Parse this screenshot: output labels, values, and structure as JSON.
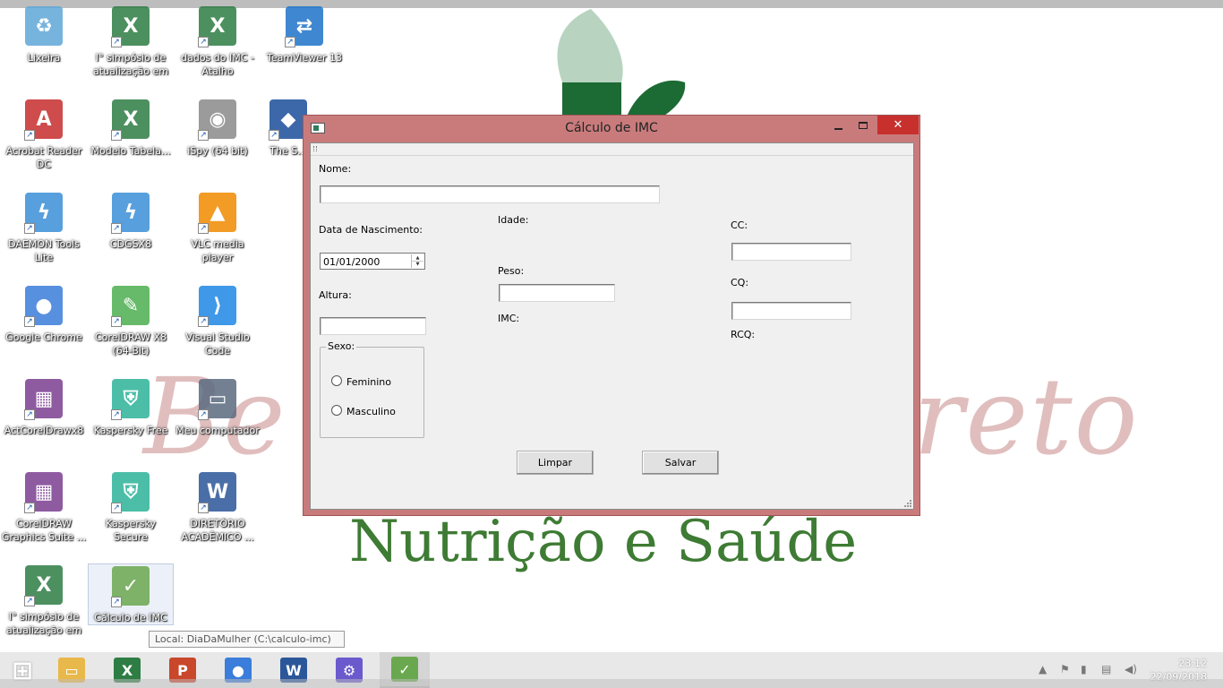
{
  "desktop": {
    "icons": [
      {
        "label": "Lixeira",
        "icon": "recycle-bin-icon",
        "color": "#5fa8d8"
      },
      {
        "label": "I° simpósio de atualização em ...",
        "icon": "excel-file-icon",
        "color": "#2e7d44"
      },
      {
        "label": "dados do IMC - Atalho",
        "icon": "excel-file-icon",
        "color": "#2e7d44"
      },
      {
        "label": "TeamViewer 13",
        "icon": "teamviewer-icon",
        "color": "#1e74c9"
      },
      {
        "label": "Acrobat Reader DC",
        "icon": "acrobat-icon",
        "color": "#c62d2d"
      },
      {
        "label": "Modelo Tabela...",
        "icon": "excel-file-icon",
        "color": "#2e7d44"
      },
      {
        "label": "iSpy (64 bit)",
        "icon": "ispy-eye-icon",
        "color": "#8a8a8a"
      },
      {
        "label": "The S...",
        "icon": "sims-icon",
        "color": "#1b4e9b"
      },
      {
        "label": "DAEMON Tools Lite",
        "icon": "daemon-tools-icon",
        "color": "#3a8fd8"
      },
      {
        "label": "CDGSX8",
        "icon": "lightning-icon",
        "color": "#3a8fd8"
      },
      {
        "label": "VLC media player",
        "icon": "vlc-cone-icon",
        "color": "#f08a00"
      },
      {
        "label": "Google Chrome",
        "icon": "chrome-icon",
        "color": "#3b7ddb"
      },
      {
        "label": "CorelDRAW X8 (64-Bit)",
        "icon": "coreldraw-icon",
        "color": "#4caf50"
      },
      {
        "label": "Visual Studio Code",
        "icon": "vscode-icon",
        "color": "#1e88e5"
      },
      {
        "label": "ActCorelDrawx8",
        "icon": "winrar-archive-icon",
        "color": "#7b3f91"
      },
      {
        "label": "Kaspersky Free",
        "icon": "kaspersky-shield-icon",
        "color": "#2db39a"
      },
      {
        "label": "Meu computador",
        "icon": "computer-icon",
        "color": "#5a6b80"
      },
      {
        "label": "CorelDRAW Graphics Suite ...",
        "icon": "winrar-archive-icon",
        "color": "#7b3f91"
      },
      {
        "label": "Kaspersky Secure Connection",
        "icon": "kaspersky-shield-icon",
        "color": "#2db39a"
      },
      {
        "label": "DIRETÓRIO ACADÊMICO ...",
        "icon": "word-file-icon",
        "color": "#2b579a"
      },
      {
        "label": "I° simpósio de atualização em ...",
        "icon": "excel-file-icon",
        "color": "#2e7d44"
      },
      {
        "label": "Cálculo de IMC",
        "icon": "imc-app-icon",
        "color": "#6aa84f"
      }
    ],
    "tooltip": "Local:     DiaDaMulher (C:\\calculo-imc)",
    "wallpaper": {
      "script_left": "Be",
      "script_right": "reto",
      "tagline": "Nutrição e Saúde",
      "leaf_color": "#1c6b34"
    }
  },
  "window": {
    "title": "Cálculo de IMC",
    "close_glyph": "✕",
    "form": {
      "nome_label": "Nome:",
      "nome_value": "",
      "data_nascimento_label": "Data de Nascimento:",
      "data_nascimento_value": "01/01/2000",
      "altura_label": "Altura:",
      "altura_value": "",
      "sexo_group_label": "Sexo:",
      "sexo_options": [
        "Feminino",
        "Masculino"
      ],
      "idade_label": "Idade:",
      "peso_label": "Peso:",
      "peso_value": "",
      "imc_label": "IMC:",
      "cc_label": "CC:",
      "cc_value": "",
      "cq_label": "CQ:",
      "cq_value": "",
      "rcq_label": "RCQ:",
      "limpar_button": "Limpar",
      "salvar_button": "Salvar"
    }
  },
  "taskbar": {
    "items": [
      {
        "icon": "windows-start-icon",
        "color": "#ffffff"
      },
      {
        "icon": "file-explorer-icon",
        "color": "#e8b84a"
      },
      {
        "icon": "excel-icon",
        "color": "#2e7d44"
      },
      {
        "icon": "powerpoint-icon",
        "color": "#c9472b"
      },
      {
        "icon": "chrome-icon",
        "color": "#3b7ddb"
      },
      {
        "icon": "word-icon",
        "color": "#2b579a"
      },
      {
        "icon": "settings-gear-icon",
        "color": "#6a5acd"
      },
      {
        "icon": "imc-app-icon",
        "color": "#6aa84f"
      }
    ],
    "time": "23:12",
    "date": "22/09/2018"
  }
}
